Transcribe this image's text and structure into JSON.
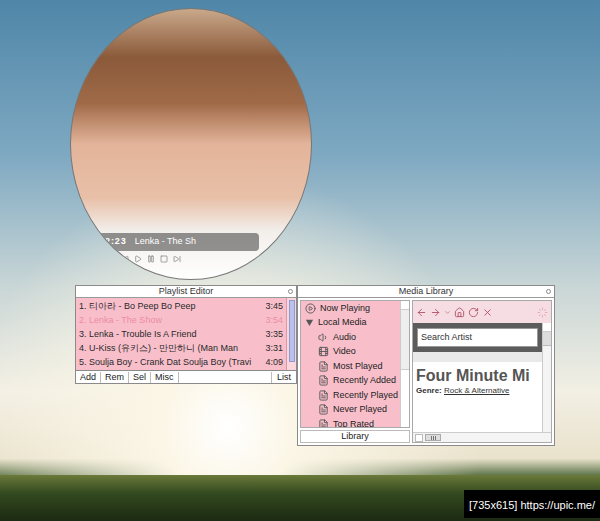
{
  "desktop": {
    "watermark": "[735x615] https://upic.me/"
  },
  "player": {
    "time": "2:23",
    "title": "Lenka - The Sh"
  },
  "playlist": {
    "title": "Playlist Editor",
    "rows": [
      {
        "text": "1. 티아라 - Bo Peep Bo Peep",
        "length": "3:45",
        "playing": false
      },
      {
        "text": "2. Lenka - The Show",
        "length": "3:54",
        "playing": true
      },
      {
        "text": "3. Lenka - Trouble Is A Friend",
        "length": "3:35",
        "playing": false
      },
      {
        "text": "4. U-Kiss (유키스) - 만만하니 (Man Man",
        "length": "3:31",
        "playing": false
      },
      {
        "text": "5. Soulja Boy - Crank Dat Soulja Boy (Travi",
        "length": "4:09",
        "playing": false
      }
    ],
    "buttons": [
      "Add",
      "Rem",
      "Sel",
      "Misc"
    ],
    "list_button": "List"
  },
  "media_library": {
    "title": "Media Library",
    "tree": [
      {
        "label": "Now Playing",
        "kind": "play"
      },
      {
        "label": "Local Media",
        "kind": "folder",
        "expanded": true
      },
      {
        "label": "Audio",
        "kind": "audio"
      },
      {
        "label": "Video",
        "kind": "video"
      },
      {
        "label": "Most Played",
        "kind": "view"
      },
      {
        "label": "Recently Added",
        "kind": "view"
      },
      {
        "label": "Recently Played",
        "kind": "view"
      },
      {
        "label": "Never Played",
        "kind": "view"
      },
      {
        "label": "Top Rated",
        "kind": "view"
      }
    ],
    "library_button": "Library",
    "browser": {
      "search_placeholder": "Search Artist",
      "heading": "Four Minute Mi",
      "genre_label": "Genre:",
      "genre": "Rock & Alternative"
    }
  }
}
